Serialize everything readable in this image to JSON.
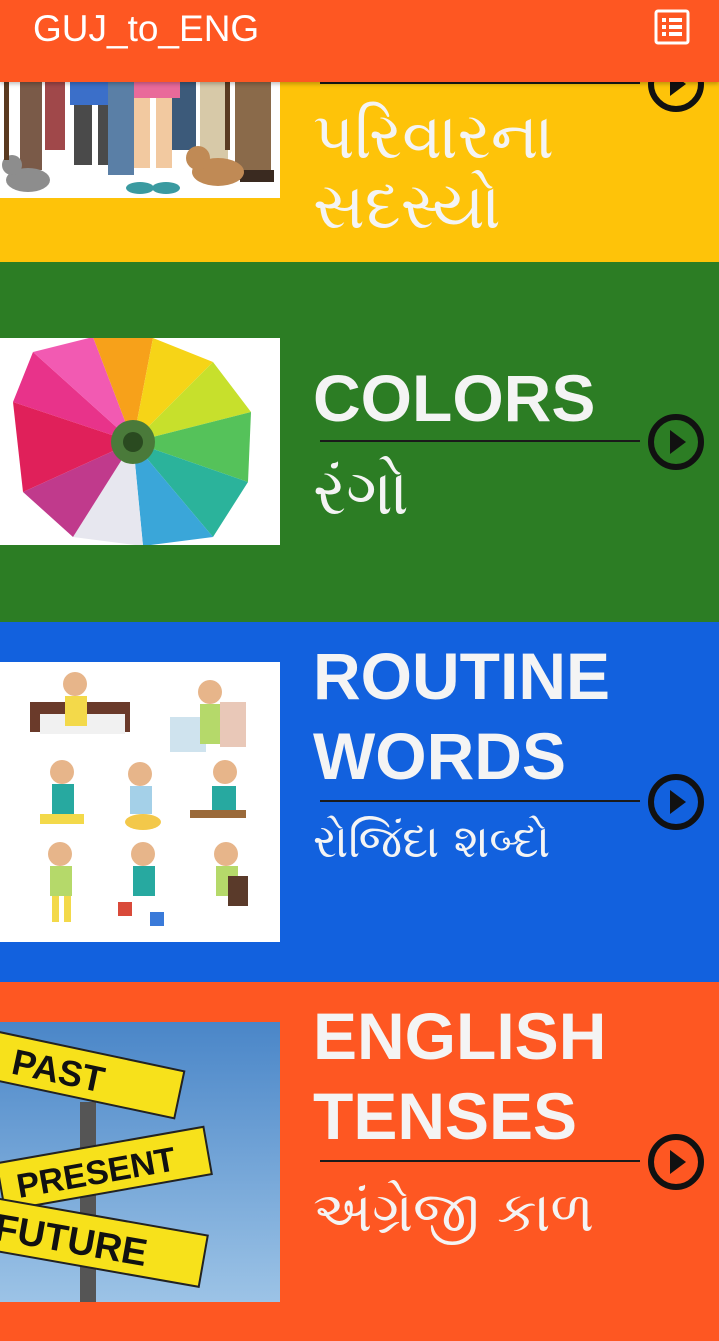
{
  "app": {
    "title": "GUJ_to_ENG"
  },
  "colors": {
    "appbar": "#fe5722",
    "family_card": "#fec309",
    "colors_card": "#2c7d24",
    "routine_card": "#1261de",
    "tenses_card": "#fe5722",
    "text": "#f4f4f4"
  },
  "cards": [
    {
      "english": "",
      "gujarati": "પરિવારના સદસ્યો"
    },
    {
      "english": "COLORS",
      "gujarati": "રંગો"
    },
    {
      "english": "ROUTINE WORDS",
      "gujarati": "રોજિંદા શબ્દો"
    },
    {
      "english": "ENGLISH TENSES",
      "gujarati": "અંગ્રેજી કાળ"
    }
  ],
  "signpost": {
    "past": "PAST",
    "present": "PRESENT",
    "future": "FUTURE"
  }
}
